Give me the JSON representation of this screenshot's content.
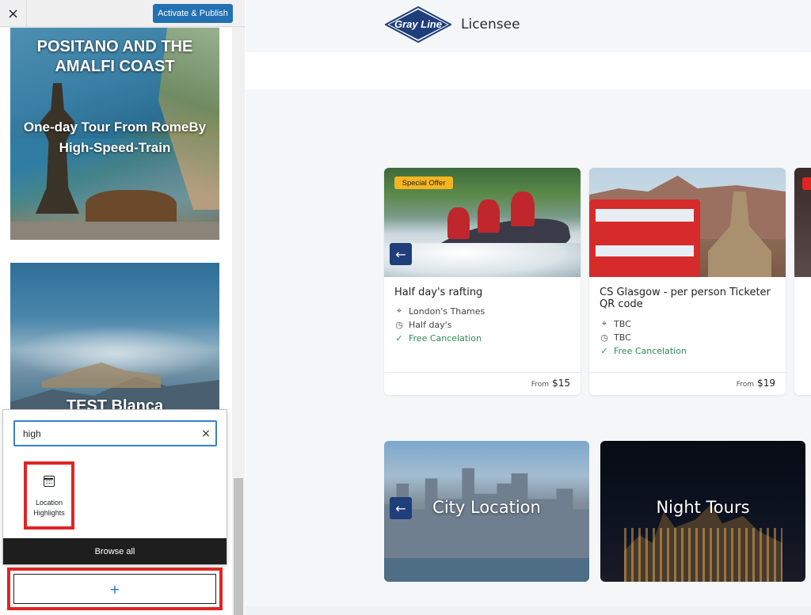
{
  "customizer": {
    "close_icon": "×",
    "publish_label": "Activate & Publish"
  },
  "sidebar": {
    "promo_cards": [
      {
        "title": "POSITANO AND THE AMALFI COAST",
        "subtitle": "One-day Tour From RomeBy High-Speed-Train"
      },
      {
        "title": "TEST Blanca"
      }
    ]
  },
  "inserter": {
    "search_value": "high",
    "clear_icon": "×",
    "results": [
      {
        "label": "Location Highlights",
        "icon": "calendar-icon"
      }
    ],
    "browse_all_label": "Browse all",
    "add_block_label": "+"
  },
  "site": {
    "logo_text": "Gray Line",
    "header_text": "Licensee"
  },
  "tours": [
    {
      "badge": "Special Offer",
      "title": "Half day's rafting",
      "location": "London's Thames",
      "duration": "Half day's",
      "cancellation": "Free Cancelation",
      "price_from": "From",
      "price": "$15"
    },
    {
      "title": "CS Glasgow - per person Ticketer QR code",
      "location": "TBC",
      "duration": "TBC",
      "cancellation": "Free Cancelation",
      "price_from": "From",
      "price": "$19"
    }
  ],
  "categories": [
    {
      "title": "City Location"
    },
    {
      "title": "Night Tours"
    }
  ],
  "icons": {
    "prev_arrow": "←",
    "location": "⌖",
    "clock": "◷",
    "check": "✓"
  },
  "colors": {
    "accent_blue": "#2271b1",
    "highlight_red": "#e02424",
    "badge_yellow": "#f5b522",
    "brand_navy": "#1f3f7a",
    "success_green": "#2e8b57"
  }
}
